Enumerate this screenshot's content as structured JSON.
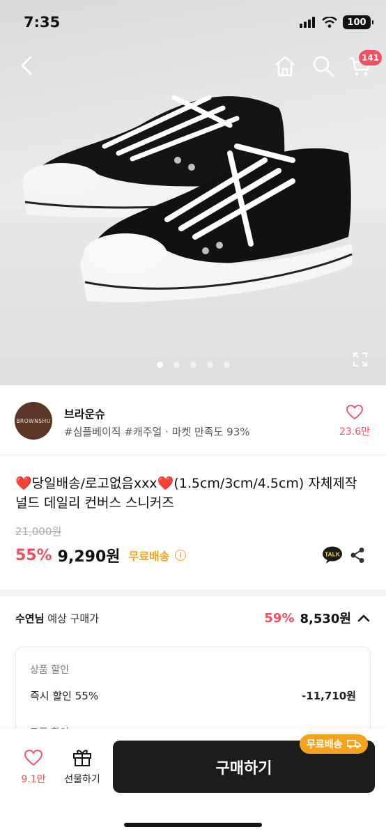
{
  "status_bar": {
    "time": "7:35",
    "battery": "100"
  },
  "nav": {
    "cart_count": "141"
  },
  "gallery": {
    "slide_count": 5,
    "active_index": 0
  },
  "shop": {
    "logo_text": "BROWNSHU",
    "name": "브라운슈",
    "tags": "#심플베이직 #캐주얼 · 마켓 만족도 93%",
    "like_count": "23.6만"
  },
  "product": {
    "heart_emoji": "❤️",
    "title_part1": "당일배송/로고없음xxx",
    "title_part2": "(1.5cm/3cm/4.5cm) 자체제작 널드 데일리 컨버스 스니커즈",
    "original_price": "21,000원",
    "discount_rate": "55%",
    "price": "9,290원",
    "free_shipping": "무료배송",
    "talk_label": "TALK"
  },
  "expected": {
    "user_name": "수연님",
    "label": "예상 구매가",
    "rate": "59%",
    "price": "8,530원"
  },
  "breakdown": {
    "section_title": "상품 할인",
    "item_label": "즉시 할인 55%",
    "item_amount": "-11,710원",
    "next_section_title": "쿠폰 할인"
  },
  "bottom_bar": {
    "wish_count": "9.1만",
    "gift_label": "선물하기",
    "buy_label": "구매하기",
    "shipping_badge": "무료배송"
  },
  "colors": {
    "accent": "#f44d5e",
    "shipping": "#f5a21c",
    "button": "#1c1c1c"
  }
}
